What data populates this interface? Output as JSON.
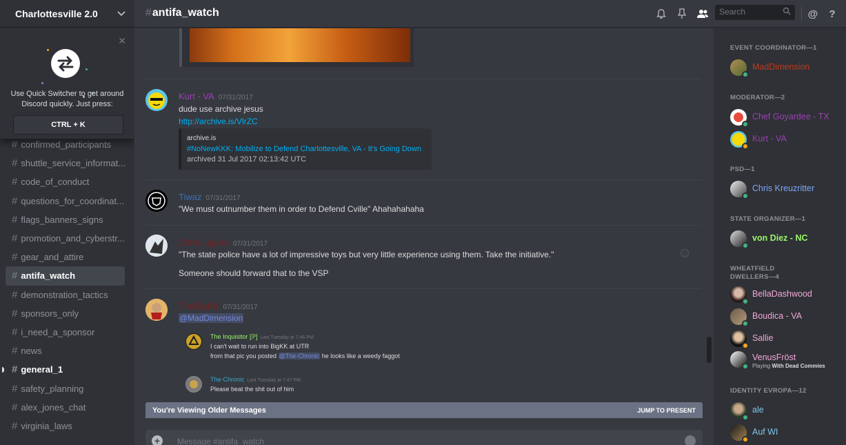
{
  "server": {
    "name": "Charlottesville 2.0"
  },
  "quick_switcher": {
    "text_line1": "Use Quick Switcher to get around",
    "text_line2": "Discord quickly. Just press:",
    "shortcut": "CTRL + K"
  },
  "channels": [
    {
      "name": "confirmed_participants",
      "state": "normal"
    },
    {
      "name": "shuttle_service_informat...",
      "state": "normal"
    },
    {
      "name": "code_of_conduct",
      "state": "normal"
    },
    {
      "name": "questions_for_coordinat...",
      "state": "normal"
    },
    {
      "name": "flags_banners_signs",
      "state": "normal"
    },
    {
      "name": "promotion_and_cyberstr...",
      "state": "normal"
    },
    {
      "name": "gear_and_attire",
      "state": "normal"
    },
    {
      "name": "antifa_watch",
      "state": "active"
    },
    {
      "name": "demonstration_tactics",
      "state": "normal"
    },
    {
      "name": "sponsors_only",
      "state": "normal"
    },
    {
      "name": "i_need_a_sponsor",
      "state": "normal"
    },
    {
      "name": "news",
      "state": "normal"
    },
    {
      "name": "general_1",
      "state": "unread"
    },
    {
      "name": "safety_planning",
      "state": "normal"
    },
    {
      "name": "alex_jones_chat",
      "state": "normal"
    },
    {
      "name": "virginia_laws",
      "state": "normal"
    }
  ],
  "topbar": {
    "channel": "antifa_watch",
    "search_placeholder": "Search"
  },
  "messages": {
    "kurt": {
      "author": "Kurt - VA",
      "timestamp": "07/31/2017",
      "line1": "dude use archive jesus",
      "link": "http://archive.is/VlrZC",
      "embed_provider": "archive.is",
      "embed_title": "#NoNewKKK: Mobilize to Defend Charlottesville, VA - It's Going Down",
      "embed_desc": "archived 31 Jul 2017 02:13:42 UTC"
    },
    "tiwaz": {
      "author": "Tiwaz",
      "timestamp": "07/31/2017",
      "line1": "\"We must outnumber them in order to Defend Cville\" Ahahahahaha"
    },
    "chris": {
      "author": "Chris Liguria",
      "timestamp": "07/31/2017",
      "line1": "\"The state police have a lot of impressive toys but very little experience using them. Take the initiative.\"",
      "line2": "Someone should forward that to the VSP"
    },
    "bigkk": {
      "author": "TheBigKK",
      "timestamp": "07/31/2017",
      "mention": "@MadDimension",
      "q1_author": "The Inquisitor [ℙ]",
      "q1_ts": "Last Tuesday at 7:46 PM",
      "q1_line1": "I can't wait to run into BigKK at UTR",
      "q1_line2_pre": "from that pic you posted ",
      "q1_mention": "@The-Chronic",
      "q1_line2_post": " he looks like a weedy faggot",
      "q2_author": "The-Chronic",
      "q2_ts": "Last Tuesday at 7:47 PM",
      "q2_line1": "Please beat the shit out of him"
    }
  },
  "older_bar": {
    "text": "You're Viewing Older Messages",
    "jump": "JUMP TO PRESENT"
  },
  "composer": {
    "placeholder": "Message #antifa_watch"
  },
  "members": {
    "groups": [
      {
        "title": "EVENT COORDINATOR—1"
      },
      {
        "title": "MODERATOR—2"
      },
      {
        "title": "PSD—1"
      },
      {
        "title": "STATE ORGANIZER—1"
      },
      {
        "title_line1": "WHEATFIELD",
        "title_line2": "DWELLERS—4"
      },
      {
        "title": "IDENTITY EVROPA—12"
      }
    ],
    "list": [
      {
        "name": "MadDimension",
        "color": "#c1391a",
        "status": "online"
      },
      {
        "name": "Chef Goyardee - TX",
        "color": "#9b3fb5",
        "status": "online"
      },
      {
        "name": "Kurt - VA",
        "color": "#9b3fb5",
        "status": "idle"
      },
      {
        "name": "Chris Kreuzritter",
        "color": "#7ea6f5",
        "status": "online"
      },
      {
        "name": "von Diez - NC",
        "color": "#9bf56d",
        "status": "online"
      },
      {
        "name": "BellaDashwood",
        "color": "#f2a7d8",
        "status": "online"
      },
      {
        "name": "Boudica - VA",
        "color": "#f2a7d8",
        "status": "online"
      },
      {
        "name": "Sallie",
        "color": "#f2a7d8",
        "status": "idle"
      },
      {
        "name": "VenusFröst",
        "color": "#f2a7d8",
        "status": "online",
        "game_pre": "Playing ",
        "game": "With Dead Commies"
      },
      {
        "name": "ale",
        "color": "#7ec6ea",
        "status": "online"
      },
      {
        "name": "Auf WI",
        "color": "#7ec6ea",
        "status": "idle"
      }
    ]
  },
  "colors": {
    "kurt": "#9b3fb5",
    "tiwaz": "#3b6fb5",
    "chris": "#7a1f1f",
    "bigkk": "#7a1f1f",
    "inquisitor": "#9bf56d",
    "chronic": "#3aa7c9",
    "online": "#43b581",
    "idle": "#faa61a"
  }
}
